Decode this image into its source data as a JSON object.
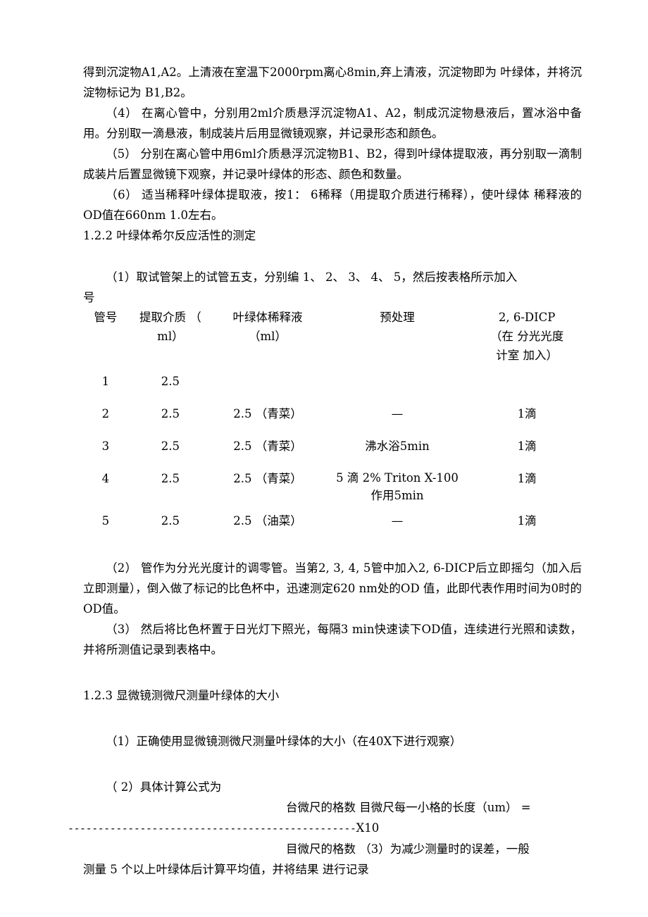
{
  "document": {
    "paragraphs_top": [
      "得到沉淀物A1,A2。上清液在室温下2000rpm离心8min,弃上清液，沉淀物即为 叶绿体，并将沉淀物标记为 B1,B2。",
      "（4） 在离心管中，分别用2ml介质悬浮沉淀物A1、A2，制成沉淀物悬液后，置冰浴中备用。分别取一滴悬液，制成装片后用显微镜观察，并记录形态和颜色。",
      "（5） 分别在离心管中用6ml介质悬浮沉淀物B1、B2，得到叶绿体提取液，再分别取一滴制成装片后置显微镜下观察，并记录叶绿体的形态、颜色和数量。",
      "（6） 适当稀释叶绿体提取液，按1： 6稀释（用提取介质进行稀释），使叶绿体 稀释液的OD值在660nm 1.0左右。"
    ],
    "section_122_heading": "1.2.2 叶绿体希尔反应活性的测定",
    "step1_text": "（1）取试管架上的试管五支，分别编 1、 2、 3、 4、 5，然后按表格所示加入",
    "step1_text_cont": "号",
    "table": {
      "headers": [
        {
          "lines": [
            "管号"
          ]
        },
        {
          "lines": [
            "提取介质 （",
            "ml）"
          ]
        },
        {
          "lines": [
            "叶绿体稀释液",
            "（ml）"
          ]
        },
        {
          "lines": [
            "预处理"
          ]
        },
        {
          "lines": [
            "2, 6-DICP",
            "（在 分光光度",
            "计室 加入）"
          ]
        }
      ],
      "rows": [
        {
          "no": "1",
          "media": "2.5",
          "dilution": "",
          "pretreat": "",
          "dicp": ""
        },
        {
          "no": "2",
          "media": "2.5",
          "dilution": "2.5 （青菜）",
          "pretreat": "—",
          "dicp": "1滴"
        },
        {
          "no": "3",
          "media": "2.5",
          "dilution": "2.5 （青菜）",
          "pretreat": "沸水浴5min",
          "dicp": "1滴"
        },
        {
          "no": "4",
          "media": "2.5",
          "dilution": "2.5 （青菜）",
          "pretreat": "5 滴 2% Triton X-100",
          "pretreat2": "作用5min",
          "dicp": "1滴"
        },
        {
          "no": "5",
          "media": "2.5",
          "dilution": "2.5 （油菜）",
          "pretreat": "—",
          "dicp": "1滴"
        }
      ]
    },
    "paragraphs_after_table": [
      "（2） 管作为分光光度计的调零管。当第2, 3, 4, 5管中加入2, 6-DICP后立即摇匀（加入后立即测量），倒入做了标记的比色杯中，迅速测定620 nm处的OD 值，此即代表作用时间为0时的OD值。",
      "（3） 然后将比色杯置于日光灯下照光，每隔3 min快速读下OD值，连续进行光照和读数，并将所测值记录到表格中。"
    ],
    "section_123_heading": "1.2.3 显微镜测微尺测量叶绿体的大小",
    "step_123_1": "（1）正确使用显微镜测微尺测量叶绿体的大小（在40X下进行观察）",
    "step_123_2": "（ 2）具体计算公式为",
    "formula": {
      "numerator": "台微尺的格数 目微尺每一小格的长度（um） =",
      "rule": "------------------------------------------------",
      "multiplier": "X10",
      "denominator_line": "目微尺的格数 （3）为减少测量时的误差，一般",
      "tail": "测量 5 个以上叶绿体后计算平均值，并将结果 进行记录"
    }
  }
}
